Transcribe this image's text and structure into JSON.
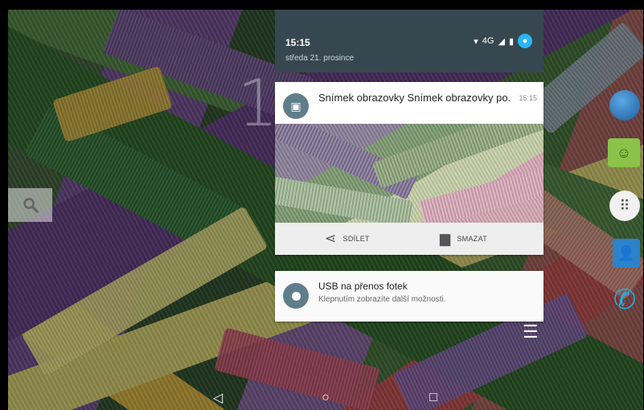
{
  "status_bar": {
    "time": "15:15",
    "date": "středa 21. prosince",
    "network": "4G",
    "icons": [
      "wifi-icon",
      "signal-icon",
      "battery-icon",
      "account-icon"
    ]
  },
  "home": {
    "clock_partial": "1"
  },
  "notifications": [
    {
      "title": "Snímek obrazovky Snímek obrazovky po...",
      "time": "15:15",
      "icon": "screenshot-icon",
      "actions": [
        {
          "label": "SDÍLET",
          "icon": "share-icon"
        },
        {
          "label": "SMAZAT",
          "icon": "trash-icon"
        }
      ]
    },
    {
      "title": "USB na přenos fotek",
      "text": "Klepnutím zobrazíte další možnosti.",
      "icon": "usb-icon"
    }
  ],
  "dock": [
    "browser-icon",
    "android-icon",
    "app-drawer-icon",
    "contacts-icon",
    "phone-icon"
  ],
  "navbar": {
    "back": "◁",
    "home": "○",
    "recents": "□"
  }
}
